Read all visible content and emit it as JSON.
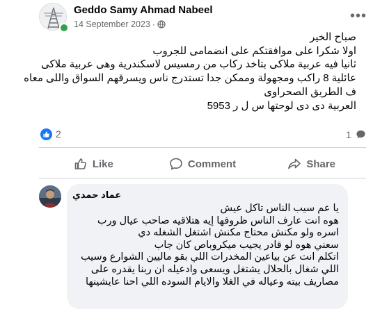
{
  "post": {
    "author": "Geddo Samy Ahmad Nabeel",
    "date": "14 September 2023",
    "audience_icon": "globe-icon",
    "more_icon": "more-horizontal-icon",
    "more_label": "•••",
    "dot": "·",
    "lines": [
      "صباح الخير",
      "اولا شكرا على موافقتكم على انضمامى للجروب",
      "ثانيا فيه عربية ملاكى بتاخد ركاب من رمسيس لاسكندرية وهى عربية ملاكى",
      "عائلية 8 راكب ومجهولة وممكن جدا تستدرج ناس ويسرقهم السواق واللى معاه",
      "ف الطريق الصحراوى",
      "العربية دى دى لوحتها س ل ر 5953"
    ]
  },
  "reactions": {
    "like_count": "2",
    "comment_count": "1",
    "like_color": "#1877f2"
  },
  "actions": {
    "like": "Like",
    "comment": "Comment",
    "share": "Share"
  },
  "comment": {
    "author": "عماد حمدي",
    "lines": [
      "يا عم سيب الناس تاكل عيش",
      "هوه انت عارف الناس ظروفها إيه هتلاقيه صاحب عيال ورب",
      "اسره ولو مكنش محتاج مكنش اشتغل الشغله دي",
      "سعني هوه لو قادر يجيب ميكروباص كان جاب",
      "اتكلم انت عن بياعين المخدرات اللي بقو ماليين الشوارع وسيب",
      "اللي شغال بالحلال يشتغل ويسعى وادعيله ان ربنا يقدره على",
      "مصاريف بيته وعياله في الغلا والايام السوده اللي احنا عايشينها"
    ]
  }
}
